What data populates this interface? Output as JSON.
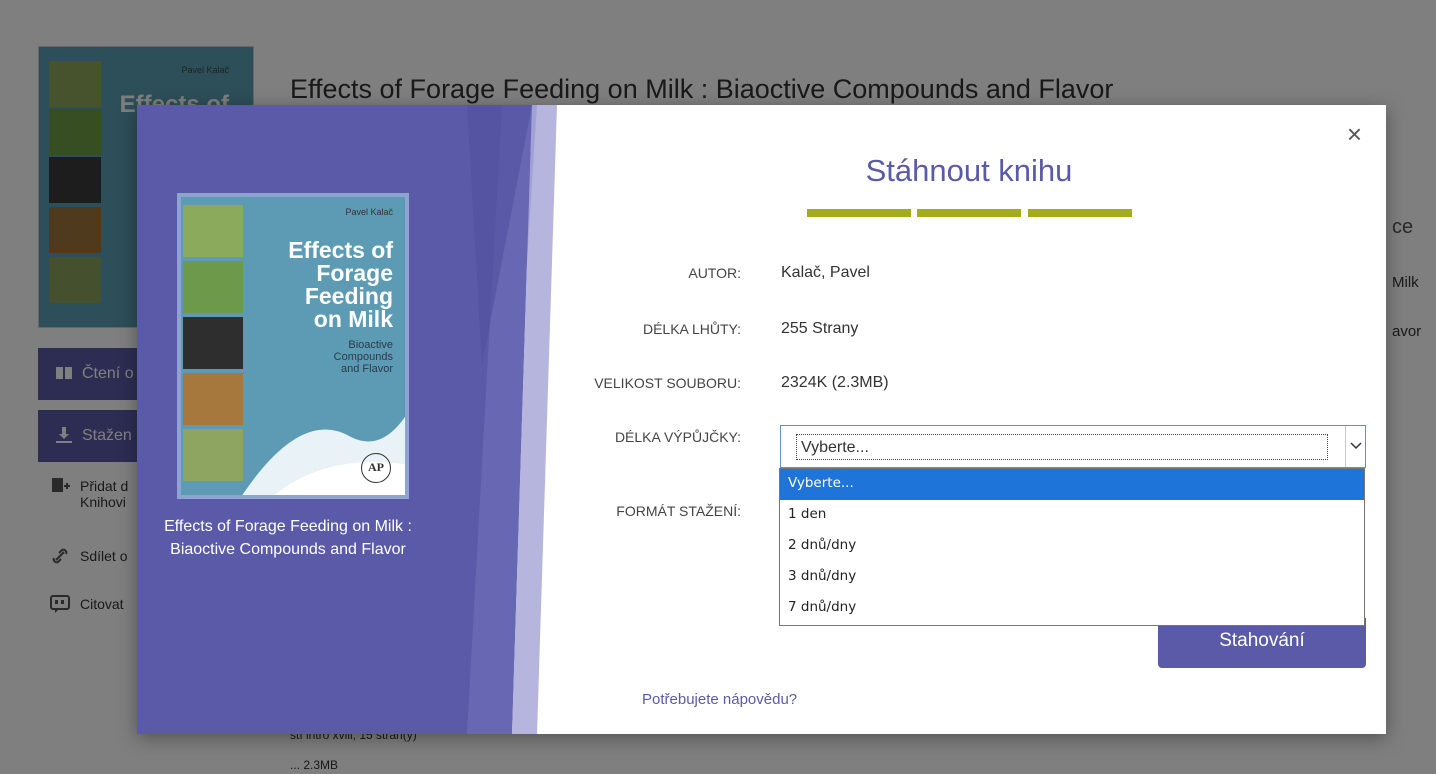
{
  "background": {
    "book_title": "Effects of Forage Feeding on Milk : Biaoctive Compounds and Flavor",
    "cover_author": "Pavel Kalač",
    "cover_title_fragment": "Effects of",
    "buttons": [
      {
        "label": "Čtení o",
        "icon": "book-icon"
      },
      {
        "label": "Stažen",
        "icon": "download-icon"
      }
    ],
    "links": [
      {
        "label": "Přidat d",
        "label2": "Knihovi",
        "icon": "add-library-icon"
      },
      {
        "label": "Sdílet o",
        "icon": "link-icon"
      },
      {
        "label": "Citovat",
        "icon": "quote-icon"
      }
    ],
    "right_fragments": {
      "heading": "ce",
      "line1": "Milk",
      "line2": "avor"
    },
    "bottom_fragments": {
      "line1": "stí intro xviii, 15 stran(y)",
      "line2": "... 2.3MB"
    }
  },
  "modal": {
    "title": "Stáhnout knihu",
    "close_glyph": "×",
    "book": {
      "title": "Effects of Forage Feeding on Milk : Biaoctive Compounds and Flavor",
      "cover": {
        "author": "Pavel Kalač",
        "title_lines": [
          "Effects of",
          "Forage",
          "Feeding",
          "on Milk"
        ],
        "subtitle_lines": [
          "Bioactive",
          "Compounds",
          "and Flavor"
        ],
        "publisher_mark": "AP"
      }
    },
    "fields": [
      {
        "label": "AUTOR:",
        "value": "Kalač, Pavel"
      },
      {
        "label": "DÉLKA LHŮTY:",
        "value": "255 Strany"
      },
      {
        "label": "VELIKOST SOUBORU:",
        "value": "2324K (2.3MB)"
      }
    ],
    "loan_length": {
      "label": "DÉLKA VÝPŮJČKY:",
      "selected": "Vyberte...",
      "options": [
        "Vyberte...",
        "1 den",
        "2 dnů/dny",
        "3 dnů/dny",
        "7 dnů/dny"
      ]
    },
    "format_label": "FORMÁT STAŽENÍ:",
    "download_button": "Stahování",
    "help_link": "Potřebujete nápovědu?"
  },
  "colors": {
    "brand_purple": "#5a5aa8",
    "accent_olive": "#a4ac19",
    "select_highlight": "#1e74d8"
  }
}
